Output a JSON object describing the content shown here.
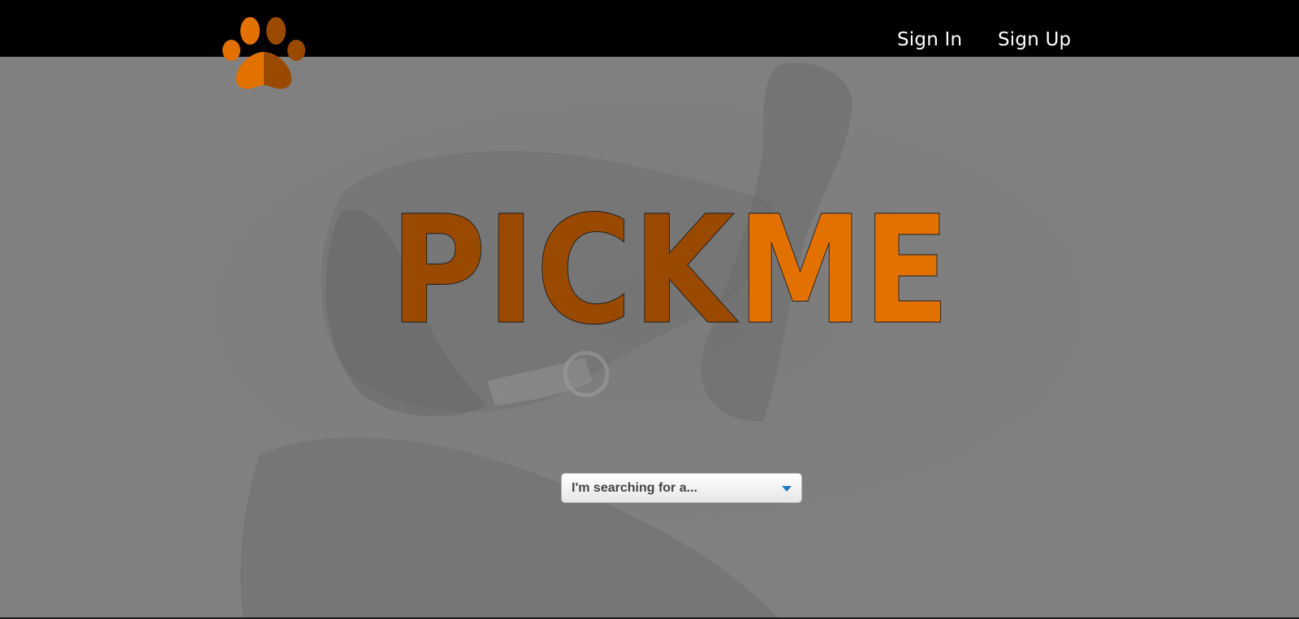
{
  "header": {
    "signin_label": "Sign In",
    "signup_label": "Sign Up"
  },
  "hero": {
    "title_part1": "PICK",
    "title_part2": "ME"
  },
  "search": {
    "selected_value": "I'm searching for a..."
  },
  "colors": {
    "header_bg": "#000000",
    "page_bg": "#808080",
    "title_dark": "#9a4a00",
    "title_light": "#e37100",
    "select_arrow": "#1f7bc0"
  },
  "icons": {
    "logo": "paw-print-icon",
    "dropdown": "caret-down-icon"
  }
}
